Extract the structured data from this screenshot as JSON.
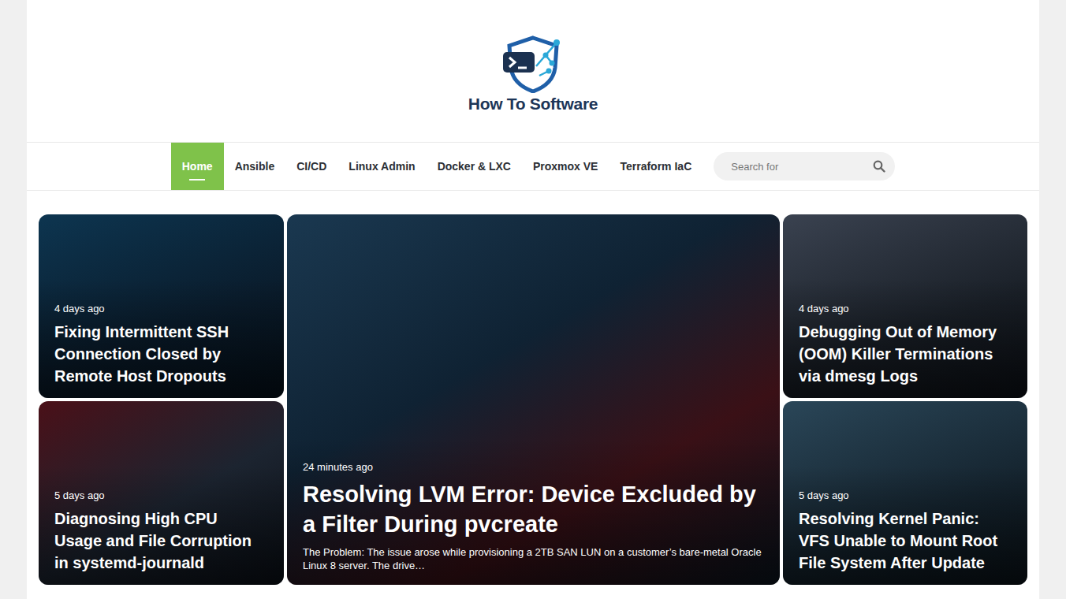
{
  "site": {
    "logo_text": "How To Software"
  },
  "nav": {
    "items": [
      {
        "label": "Home",
        "selected": true
      },
      {
        "label": "Ansible",
        "selected": false
      },
      {
        "label": "CI/CD",
        "selected": false
      },
      {
        "label": "Linux Admin",
        "selected": false
      },
      {
        "label": "Docker & LXC",
        "selected": false
      },
      {
        "label": "Proxmox VE",
        "selected": false
      },
      {
        "label": "Terraform IaC",
        "selected": false
      }
    ]
  },
  "search": {
    "placeholder": "Search for"
  },
  "posts": [
    {
      "kind": "standard",
      "time": "4 days ago",
      "title": "Fixing Intermittent SSH Connection Closed by Remote Host Dropouts"
    },
    {
      "kind": "featured",
      "time": "24 minutes ago",
      "title": "Resolving LVM Error: Device Excluded by a Filter During pvcreate",
      "excerpt": "The Problem: The issue arose while provisioning a 2TB SAN LUN on a customer’s bare-metal Oracle Linux 8 server. The drive…"
    },
    {
      "kind": "standard",
      "time": "4 days ago",
      "title": "Debugging Out of Memory (OOM) Killer Terminations via dmesg Logs"
    },
    {
      "kind": "standard",
      "time": "5 days ago",
      "title": "Diagnosing High CPU Usage and File Corruption in systemd-journald"
    },
    {
      "kind": "standard",
      "time": "5 days ago",
      "title": "Resolving Kernel Panic: VFS Unable to Mount Root File System After Update"
    }
  ]
}
